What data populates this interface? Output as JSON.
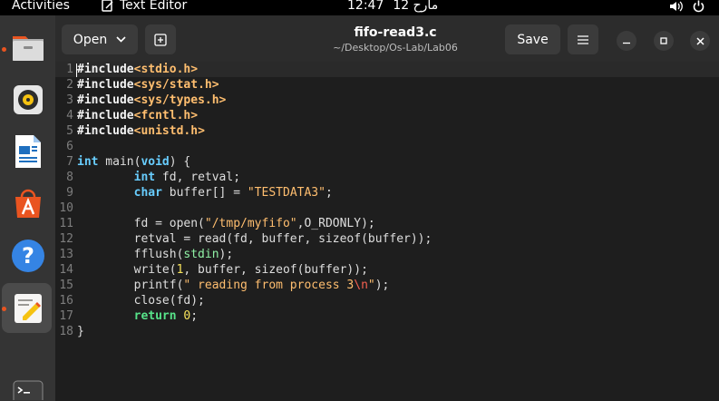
{
  "topbar": {
    "activities": "Activities",
    "app_name": "Text Editor",
    "time": "12:47",
    "date": "12 مارح"
  },
  "header": {
    "open_label": "Open",
    "save_label": "Save",
    "title": "fifo-read3.c",
    "subtitle": "~/Desktop/Os-Lab/Lab06"
  },
  "editor": {
    "line_numbers": [
      "1",
      "2",
      "3",
      "4",
      "5",
      "6",
      "7",
      "8",
      "9",
      "10",
      "11",
      "12",
      "13",
      "14",
      "15",
      "16",
      "17",
      "18"
    ]
  },
  "colors": {
    "keyword": "#68cdfe",
    "string": "#ffbe6f",
    "number": "#f8e45c",
    "return": "#57e389",
    "accent": "#e95420"
  },
  "icons": [
    "files-icon",
    "rhythmbox-icon",
    "writer-icon",
    "software-icon",
    "help-icon",
    "text-editor-icon",
    "terminal-icon"
  ]
}
